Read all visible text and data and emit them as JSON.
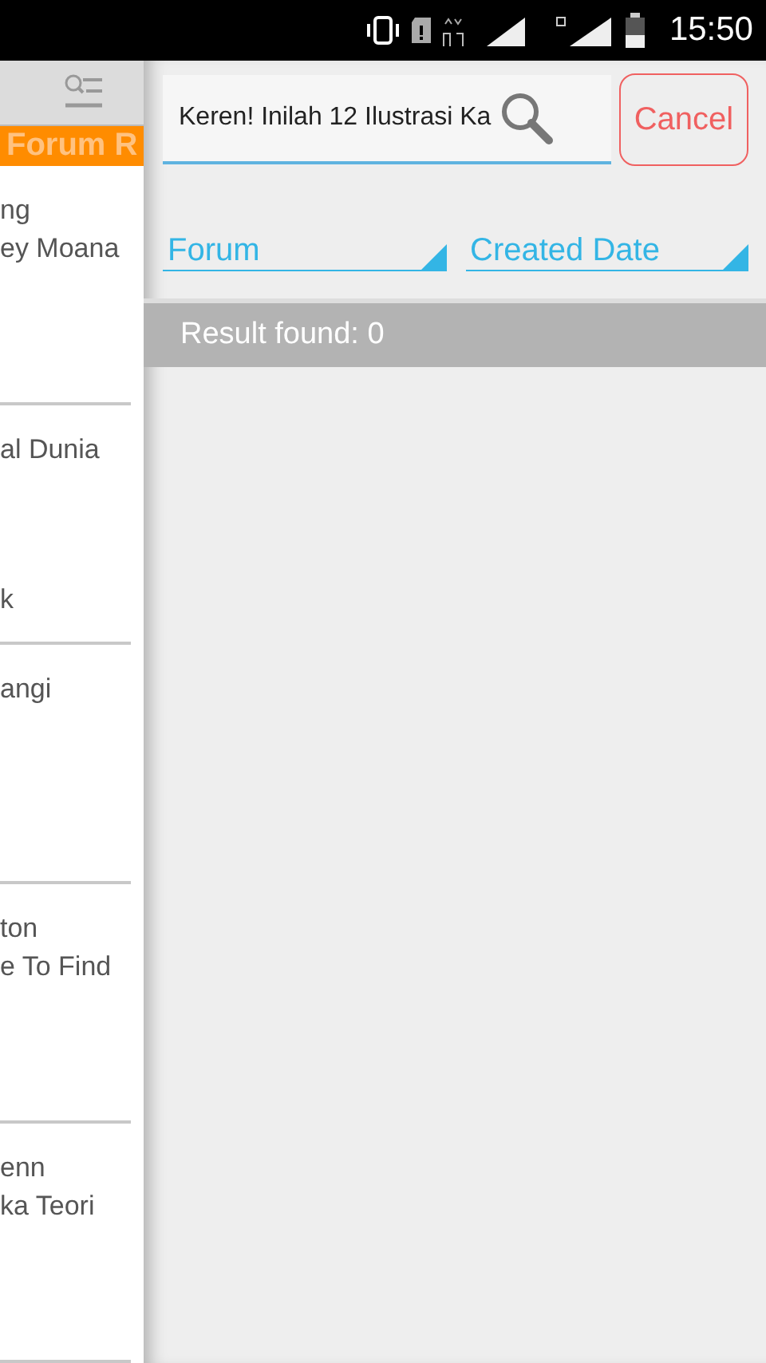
{
  "status_bar": {
    "time": "15:50"
  },
  "background_list": {
    "header_label": "Forum R",
    "items": [
      {
        "title_lines": [
          "ng",
          "ey Moana"
        ]
      },
      {
        "title_lines": [
          "al Dunia"
        ],
        "meta": "k"
      },
      {
        "title_lines": [
          "angi"
        ]
      },
      {
        "title_lines": [
          "ton",
          "e To Find"
        ]
      },
      {
        "title_lines": [
          "enn",
          "ka Teori"
        ]
      }
    ]
  },
  "search": {
    "value": "Keren! Inilah 12 Ilustrasi Ka",
    "cancel": "Cancel"
  },
  "filters": [
    {
      "label": "Forum"
    },
    {
      "label": "Created Date"
    }
  ],
  "result": "Result found: 0"
}
